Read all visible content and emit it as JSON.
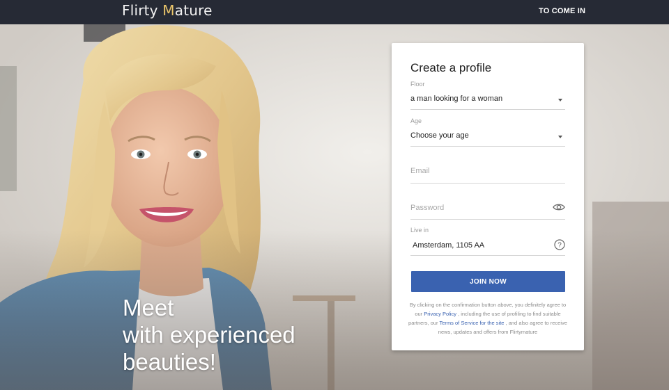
{
  "header": {
    "logo_part1": "Flirty ",
    "logo_part2": "M",
    "logo_part3": "ature",
    "login_label": "TO COME IN"
  },
  "hero": {
    "line1": "Meet",
    "line2": "with experienced",
    "line3": "beauties!"
  },
  "form": {
    "title": "Create a profile",
    "floor": {
      "label": "Floor",
      "value": "a man looking for a woman"
    },
    "age": {
      "label": "Age",
      "value": "Choose your age"
    },
    "email": {
      "placeholder": "Email"
    },
    "password": {
      "placeholder": "Password"
    },
    "live_in": {
      "label": "Live in",
      "value": "Amsterdam, 1105 AA"
    },
    "join_label": "JOIN NOW",
    "legal": {
      "part1": "By clicking on the confirmation button above, you definitely agree to our ",
      "privacy_link": "Privacy Policy",
      "part2": " , including the use of profiling to find suitable partners, our ",
      "terms_link": "Terms of Service for the site",
      "part3": " , and also agree to receive news, updates and offers from Flirtymature"
    }
  },
  "colors": {
    "topbar": "#262a35",
    "logo_accent": "#e9c46a",
    "button": "#3a62b0",
    "link": "#3a62b0"
  },
  "icons": [
    "eye-icon",
    "help-icon",
    "chevron-down-icon"
  ]
}
